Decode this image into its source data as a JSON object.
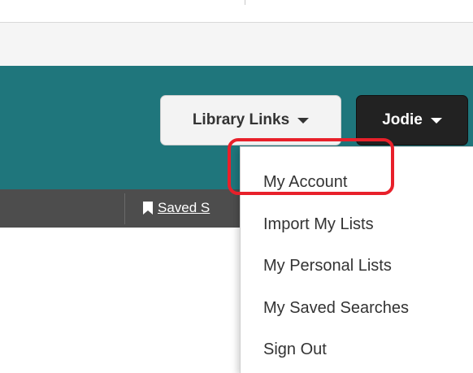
{
  "header": {
    "library_links_label": "Library Links",
    "user_label": "Jodie"
  },
  "nav": {
    "saved_label": "Saved S"
  },
  "user_menu": {
    "items": [
      {
        "label": "My Account"
      },
      {
        "label": "Import My Lists"
      },
      {
        "label": "My Personal Lists"
      },
      {
        "label": "My Saved Searches"
      },
      {
        "label": "Sign Out"
      }
    ]
  },
  "colors": {
    "header_band": "#1f767c",
    "nav_bar": "#4d4d4d",
    "highlight": "#e8202a",
    "user_button": "#222222"
  },
  "icons": {
    "bookmark": "bookmark-icon",
    "dropdown": "chevron-down-icon"
  }
}
